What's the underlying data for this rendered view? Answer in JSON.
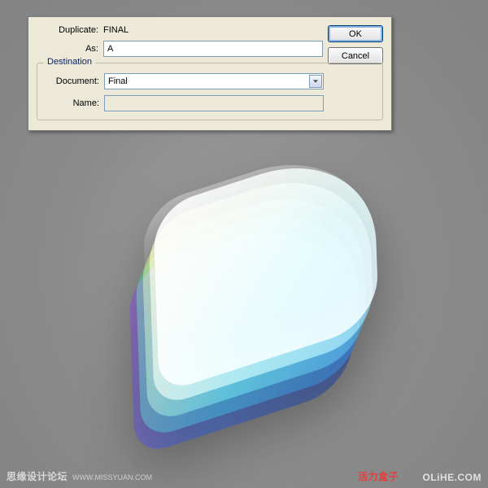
{
  "dialog": {
    "duplicate_label": "Duplicate:",
    "duplicate_value": "FINAL",
    "as_label": "As:",
    "as_value": "A",
    "destination_legend": "Destination",
    "document_label": "Document:",
    "document_value": "Final",
    "name_label": "Name:",
    "name_value": "",
    "ok_label": "OK",
    "cancel_label": "Cancel"
  },
  "watermarks": {
    "left_main": "思缘设计论坛",
    "left_sub": "WWW.MISSYUAN.COM",
    "mid": "活力盒子",
    "right": "OLiHE.COM"
  }
}
